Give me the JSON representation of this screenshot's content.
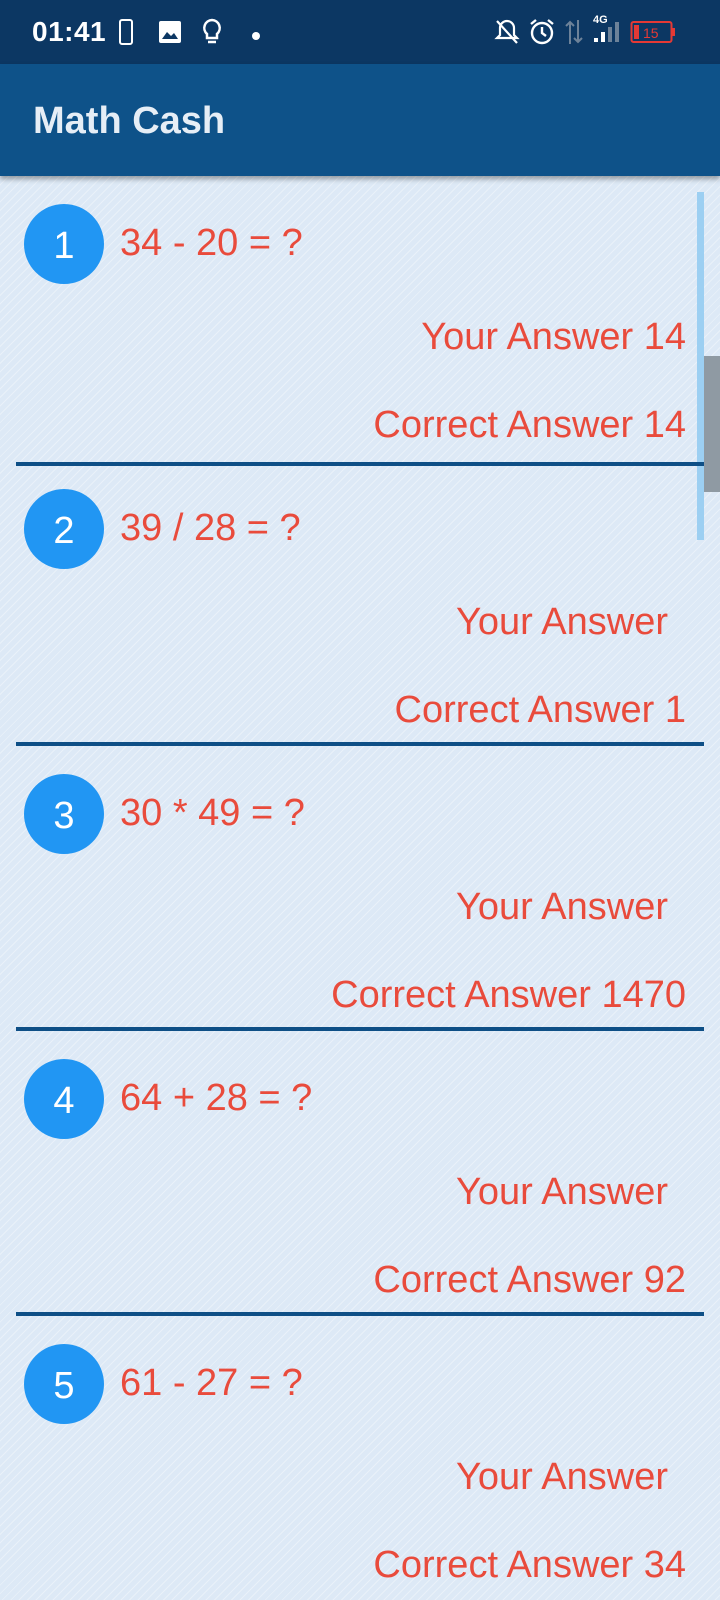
{
  "status_bar": {
    "time": "01:41",
    "battery": "15",
    "network": "4G"
  },
  "app": {
    "title": "Math Cash"
  },
  "results": [
    {
      "number": "1",
      "question": "34 - 20 = ?",
      "your_answer": "Your Answer 14",
      "correct_answer": "Correct Answer 14"
    },
    {
      "number": "2",
      "question": "39 / 28 = ?",
      "your_answer": "Your Answer",
      "correct_answer": "Correct Answer 1"
    },
    {
      "number": "3",
      "question": "30 * 49 = ?",
      "your_answer": "Your Answer",
      "correct_answer": "Correct Answer 1470"
    },
    {
      "number": "4",
      "question": "64 + 28 = ?",
      "your_answer": "Your Answer",
      "correct_answer": "Correct Answer 92"
    },
    {
      "number": "5",
      "question": "61 - 27 = ?",
      "your_answer": "Your Answer",
      "correct_answer": "Correct Answer 34"
    }
  ],
  "icons": {
    "status_left": [
      "phone-outline-icon",
      "image-icon",
      "lightbulb-icon",
      "dot-icon"
    ],
    "status_right": [
      "notifications-off-icon",
      "alarm-icon",
      "data-arrows-icon",
      "signal-icon",
      "battery-icon"
    ]
  },
  "colors": {
    "status_bar": "#0c3763",
    "app_bar": "#0e5289",
    "accent_circle": "#2196f3",
    "text_red": "#e94b3c",
    "divider": "#0e4f86",
    "background": "#dde9f6"
  }
}
